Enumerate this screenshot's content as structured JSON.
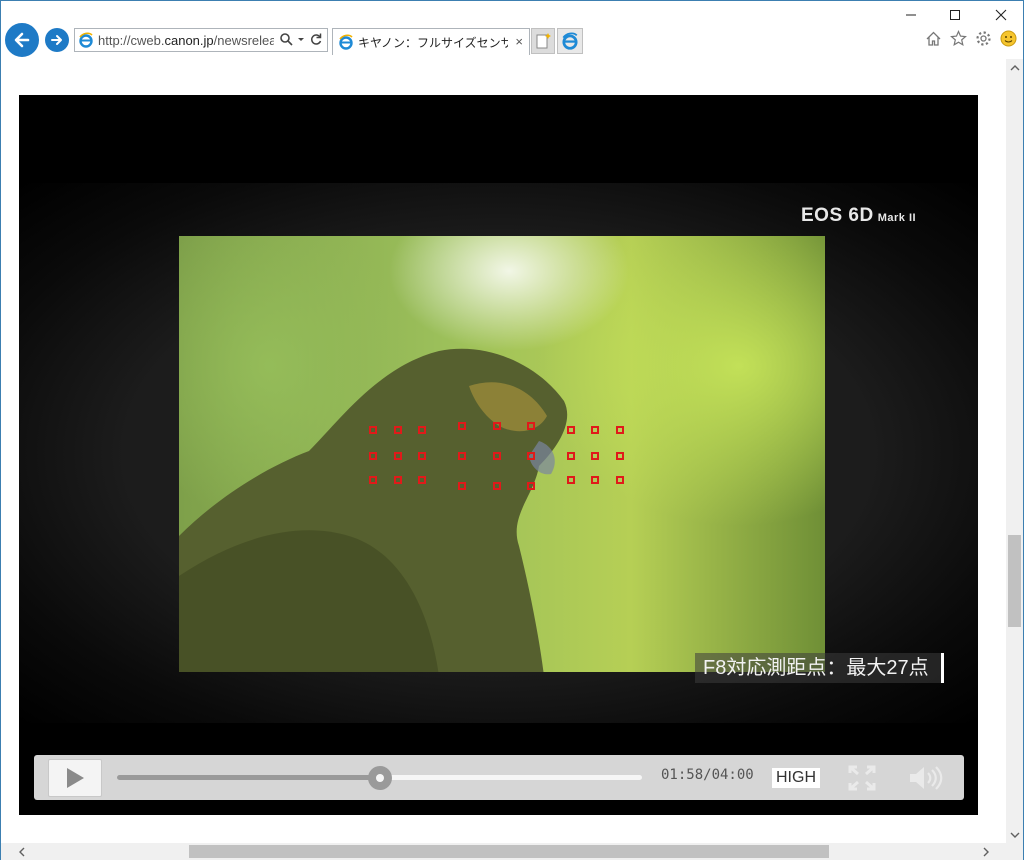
{
  "browser": {
    "address_url_prefix": "http://cweb.",
    "address_url_domain": "canon.jp",
    "address_url_suffix": "/newsrelease",
    "tab_title": "キヤノン：フルサイズセンサー",
    "tab_close": "×"
  },
  "video": {
    "brand_main": "EOS 6D",
    "brand_sub": "Mark II",
    "subtitle": "F8対応測距点：最大27点",
    "current_time": "01:58",
    "duration": "04:00",
    "time_display": "01:58/04:00",
    "progress": 0.5,
    "quality_label": "HIGH"
  },
  "colors": {
    "browser_accent": "#1e7ac6",
    "af_point": "#e01a1a",
    "controls_bg": "#d6d6d6"
  }
}
